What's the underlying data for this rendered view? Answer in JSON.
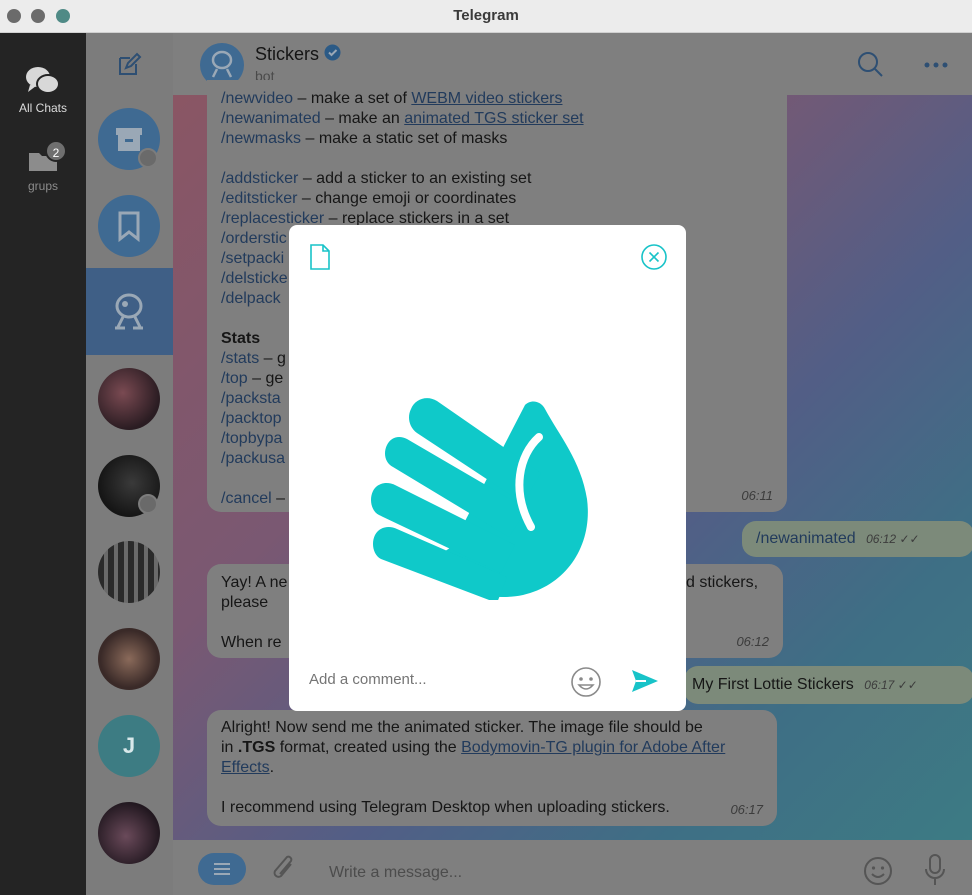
{
  "window": {
    "title": "Telegram"
  },
  "folders": [
    {
      "label": "All Chats",
      "icon": "chats-icon",
      "active": true
    },
    {
      "label": "grups",
      "icon": "folder-icon",
      "badge": "2"
    }
  ],
  "chat_list": {
    "avatars": [
      "archive",
      "saved",
      "stickers-bot",
      "photo",
      "photo",
      "photo",
      "photo",
      "J",
      "photo"
    ]
  },
  "header": {
    "name": "Stickers",
    "verified": true,
    "subtitle": "bot"
  },
  "messages": {
    "m1": {
      "lines": [
        {
          "cmd": "/newvideo",
          "text": " – make a set of ",
          "link": "WEBM video stickers"
        },
        {
          "cmd": "/newanimated",
          "text": " – make an ",
          "link": "animated TGS sticker set"
        },
        {
          "cmd": "/newmasks",
          "text": " – make a static set of masks"
        },
        {
          "cmd": "/addsticker",
          "text": " – add a sticker to an existing set"
        },
        {
          "cmd": "/editsticker",
          "text": " – change emoji or coordinates"
        },
        {
          "cmd": "/replacesticker",
          "text": " – replace stickers in a set"
        },
        {
          "cmd": "/orderstic",
          "text": ""
        },
        {
          "cmd": "/setpacki",
          "text": ""
        },
        {
          "cmd": "/delsticke",
          "text": ""
        },
        {
          "cmd": "/delpack",
          "text": ""
        },
        {
          "heading": "Stats"
        },
        {
          "cmd": "/stats",
          "text": " – g"
        },
        {
          "cmd": "/top",
          "text": " – ge"
        },
        {
          "cmd": "/packsta",
          "text": ""
        },
        {
          "cmd": "/packtop",
          "text": ""
        },
        {
          "cmd": "/topbypa",
          "text": ""
        },
        {
          "cmd": "/packusa",
          "text": ""
        },
        {
          "cmd": "/cancel",
          "text": " –"
        }
      ],
      "time": "06:11"
    },
    "m2": {
      "text": "/newanimated",
      "time": "06:12",
      "ticks": "✓✓"
    },
    "m3": {
      "line1_a": "Yay! A ne",
      "line1_b": "d stickers,",
      "line2": "please",
      "line3": "When re",
      "time": "06:12"
    },
    "m4": {
      "text": "My First Lottie Stickers",
      "time": "06:17",
      "ticks": "✓✓"
    },
    "m5": {
      "line1": "Alright! Now send me the animated sticker. The image file should be",
      "line2_a": "in ",
      "line2_b": ".TGS",
      "line2_c": " format, created using the ",
      "link_a": "Bodymovin-TG plugin for Adobe After",
      "link_b": "Effects",
      "line3_end": ".",
      "line4": "I recommend using Telegram Desktop when uploading stickers.",
      "time": "06:17"
    }
  },
  "composer": {
    "placeholder": "Write a message..."
  },
  "modal": {
    "comment_placeholder": "Add a comment...",
    "sticker": "waving-hand",
    "accent": "#0fc9c9"
  }
}
